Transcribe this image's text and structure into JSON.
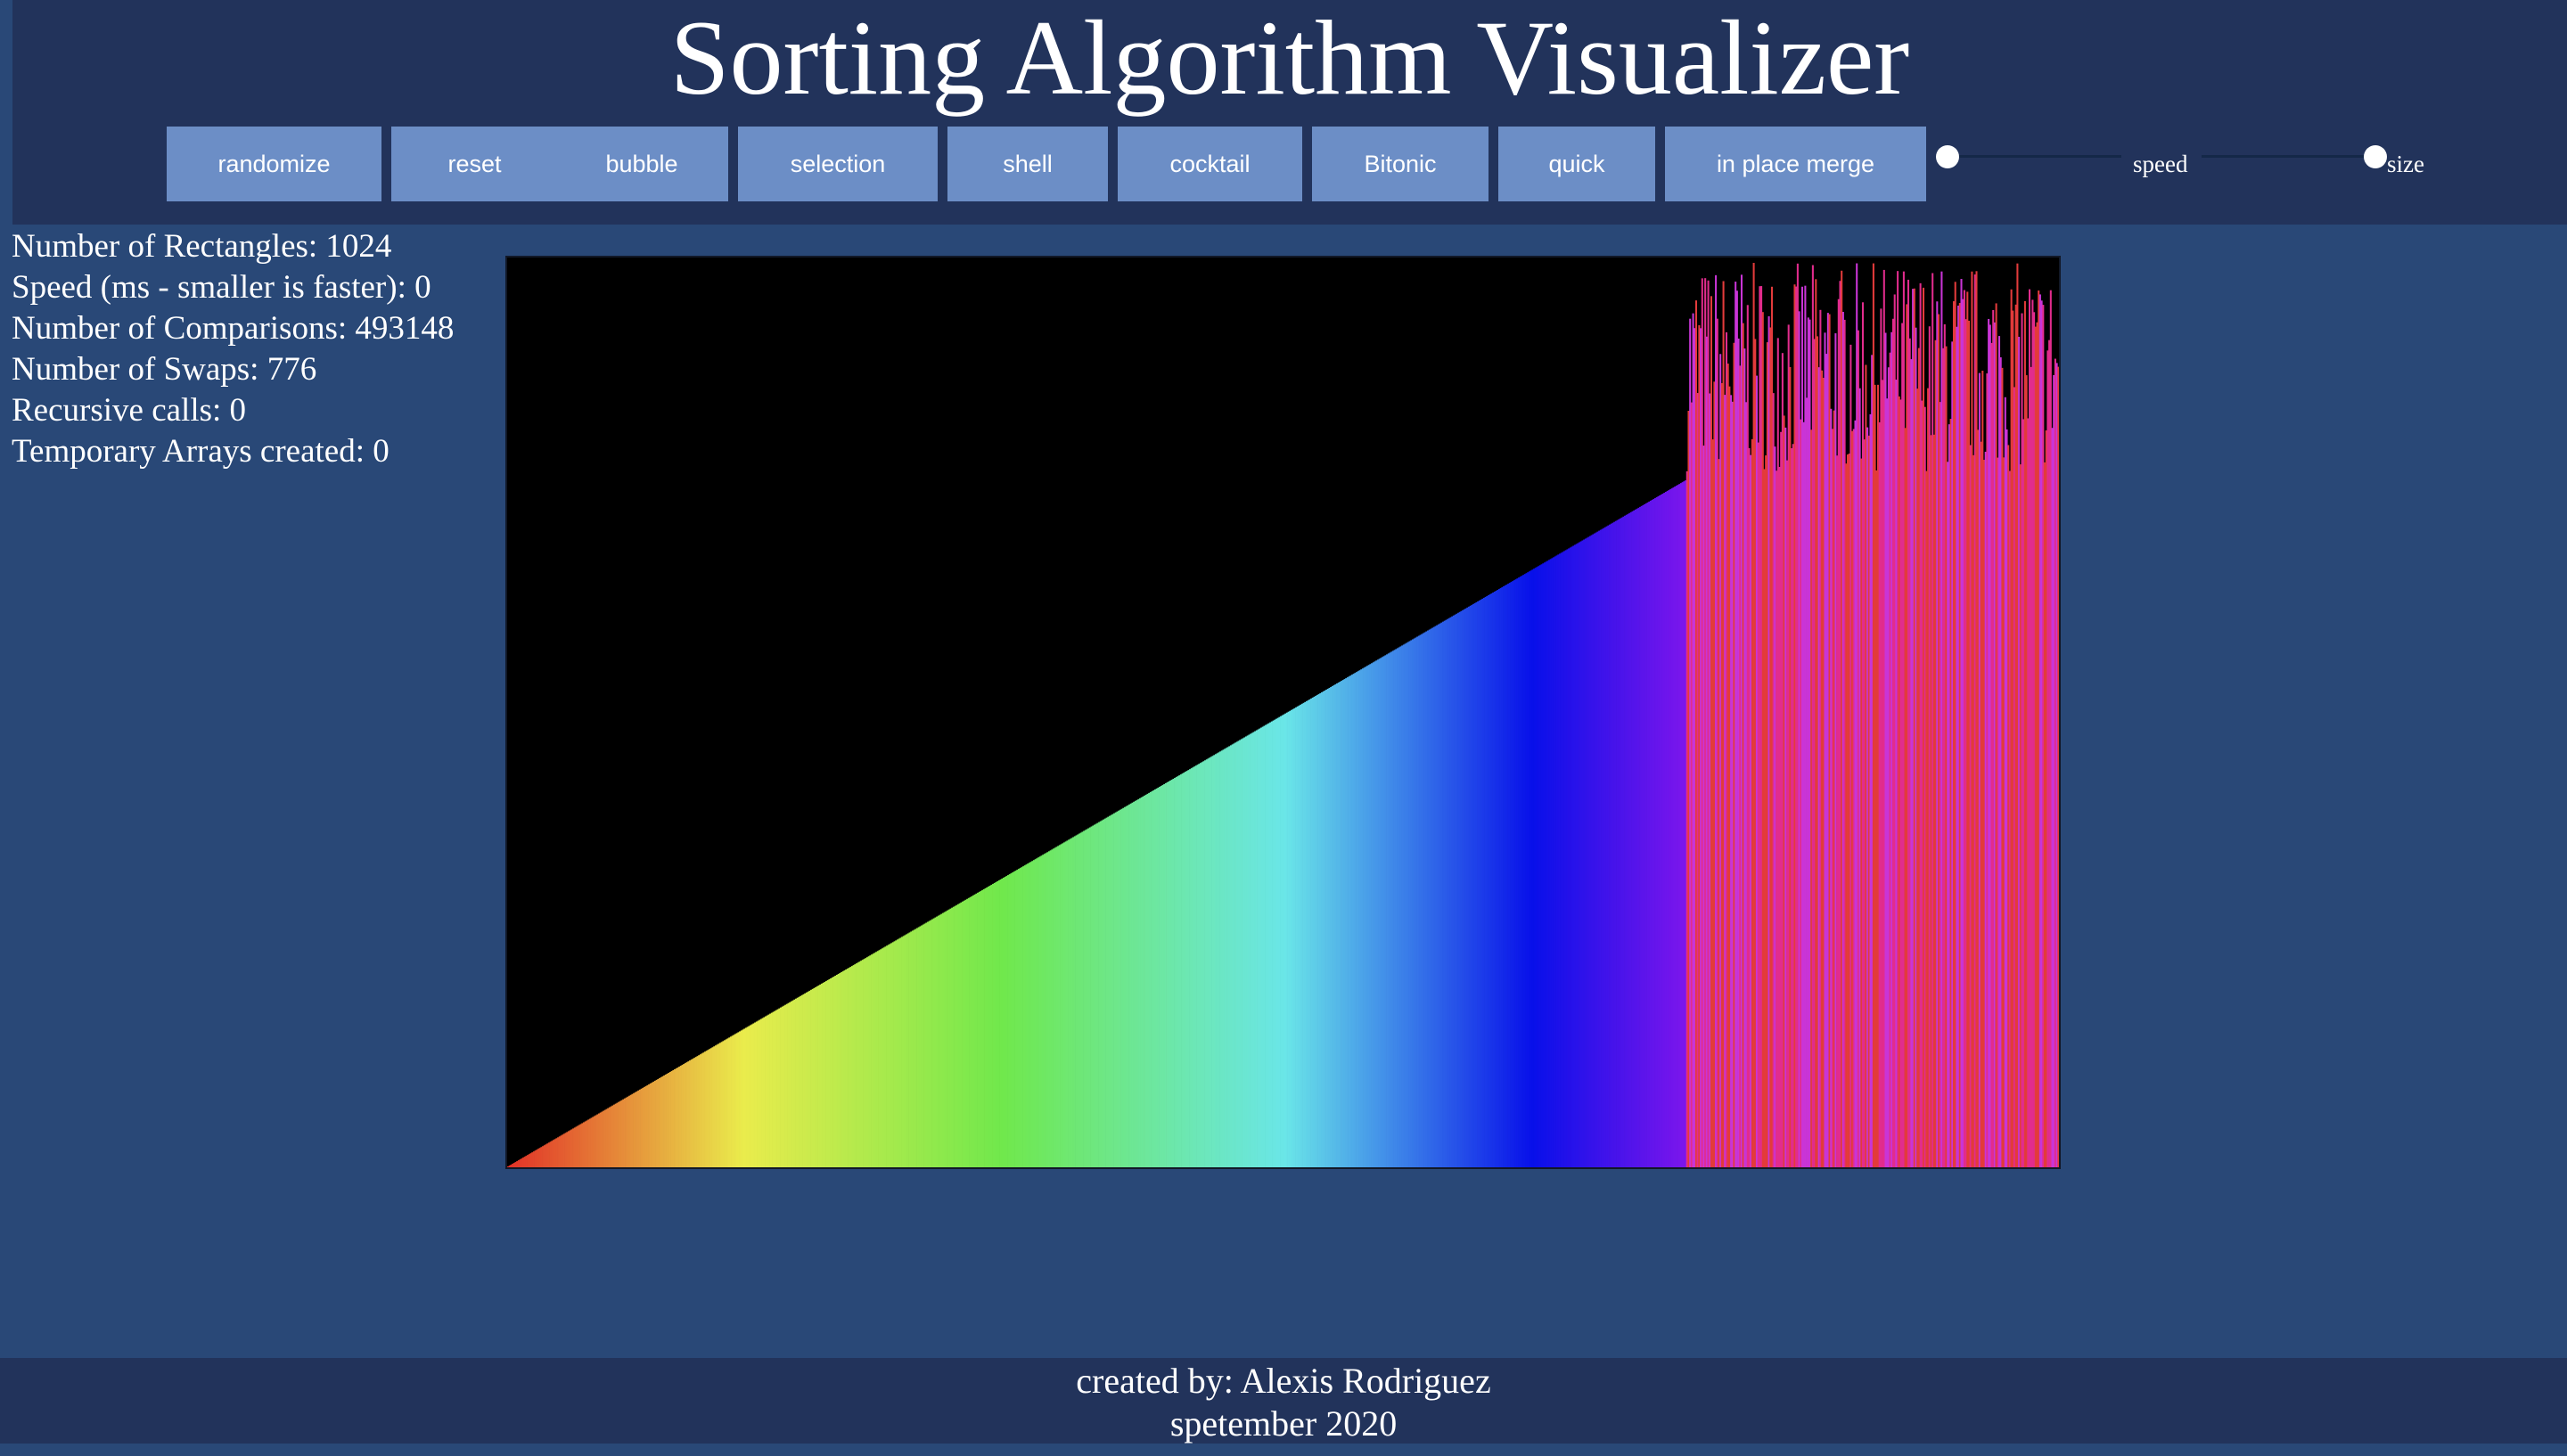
{
  "header": {
    "title": "Sorting Algorithm Visualizer"
  },
  "toolbar": {
    "buttons": [
      {
        "id": "randomize",
        "label": "randomize"
      },
      {
        "id": "reset",
        "label": "reset"
      },
      {
        "id": "bubble",
        "label": "bubble"
      },
      {
        "id": "selection",
        "label": "selection"
      },
      {
        "id": "shell",
        "label": "shell"
      },
      {
        "id": "cocktail",
        "label": "cocktail"
      },
      {
        "id": "bitonic",
        "label": "Bitonic"
      },
      {
        "id": "quick",
        "label": "quick"
      },
      {
        "id": "merge",
        "label": "in place merge"
      }
    ],
    "speed_label": "speed",
    "size_label": "size",
    "speed_value": 0,
    "size_value": 1
  },
  "stats": {
    "rectangles": "Number of Rectangles: 1024",
    "speed": "Speed (ms - smaller is faster): 0",
    "comparisons": "Number of Comparisons: 493148",
    "swaps": "Number of Swaps: 776",
    "recursive_calls": "Recursive calls: 0",
    "temp_arrays": "Temporary Arrays created: 0"
  },
  "visualizer": {
    "background": "#000000",
    "bar_count": 1024,
    "sorted_fraction": 0.76,
    "sorted_max_height_fraction": 0.755,
    "unsorted_bar_colors": [
      "#e33b3b",
      "#c935d6",
      "#e22c8d"
    ]
  },
  "footer": {
    "credit": "created by: Alexis Rodriguez",
    "date": "spetember 2020"
  }
}
